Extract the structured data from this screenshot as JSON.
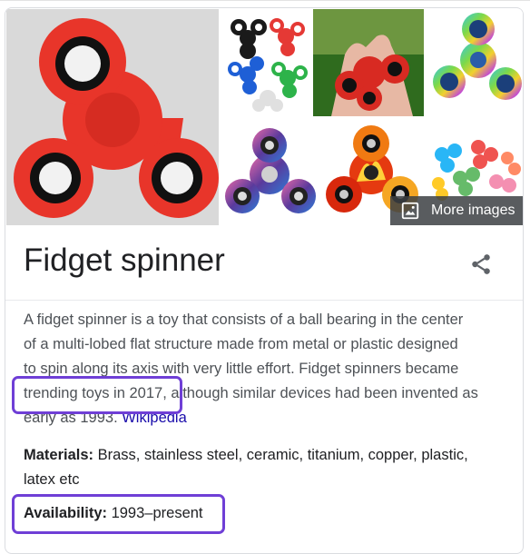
{
  "knowledge_panel": {
    "title": "Fidget spinner",
    "more_images_label": "More images",
    "description": {
      "line1": "A fidget spinner is a toy that consists of a ball bearing in the center",
      "line2": "of a multi-lobed flat structure made from metal or plastic designed",
      "line3": "to spin along its axis with very little effort. Fidget spinners became",
      "line4": "trending toys in 2017, although similar devices had been invented as",
      "line5_text": "early as 1993. ",
      "source_link": "Wikipedia"
    },
    "facts": {
      "materials_label": "Materials:",
      "materials_value": " Brass, stainless steel, ceramic, titanium, copper, plastic,",
      "materials_value_cont": "latex etc",
      "availability_label": "Availability:",
      "availability_value": " 1993–present"
    }
  },
  "icons": {
    "more_images": "image-icon",
    "share": "share-icon"
  },
  "colors": {
    "highlight_border": "#6f3fd6",
    "link": "#1a0dab",
    "spinner_red": "#e8352a",
    "overlay": "#3c4043"
  }
}
